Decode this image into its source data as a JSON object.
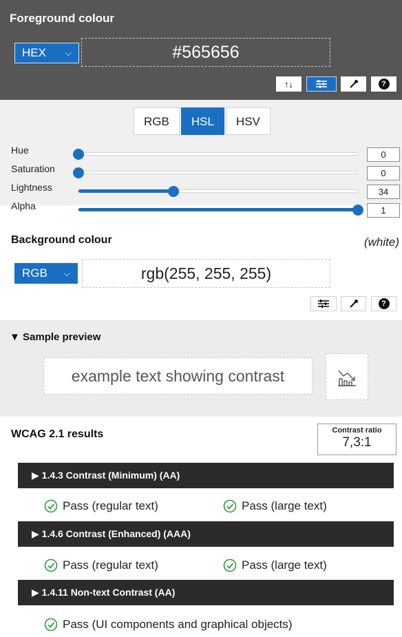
{
  "foreground": {
    "title": "Foreground colour",
    "format": "HEX",
    "value": "#565656",
    "tools": [
      "swap-icon",
      "sliders-icon",
      "eyedropper-icon",
      "help-icon"
    ],
    "help_glyph": "?",
    "swap_glyph": "↑↓",
    "background_color": "#565656"
  },
  "sliders": {
    "tabs": [
      "RGB",
      "HSL",
      "HSV"
    ],
    "active_tab": "HSL",
    "rows": [
      {
        "label": "Hue",
        "value": "0",
        "fraction": 0.0
      },
      {
        "label": "Saturation",
        "value": "0",
        "fraction": 0.0
      },
      {
        "label": "Lightness",
        "value": "34",
        "fraction": 0.34
      },
      {
        "label": "Alpha",
        "value": "1",
        "fraction": 1.0
      }
    ]
  },
  "background": {
    "title": "Background colour",
    "name": "(white)",
    "format": "RGB",
    "value": "rgb(255, 255, 255)",
    "help_glyph": "?"
  },
  "preview": {
    "title": "▼ Sample preview",
    "sample_text": "example text showing contrast"
  },
  "results": {
    "title": "WCAG 2.1 results",
    "ratio_label": "Contrast ratio",
    "ratio_value": "7,3:1",
    "criteria": [
      {
        "label": "▶  1.4.3 Contrast (Minimum) (AA)",
        "results": [
          "Pass (regular text)",
          "Pass (large text)"
        ]
      },
      {
        "label": "▶  1.4.6 Contrast (Enhanced) (AAA)",
        "results": [
          "Pass (regular text)",
          "Pass (large text)"
        ]
      },
      {
        "label": "▶  1.4.11 Non-text Contrast (AA)",
        "results": [
          "Pass (UI components and graphical objects)"
        ]
      }
    ]
  },
  "colors": {
    "accent": "#1a6fc3",
    "pass": "#2e9d3e",
    "dark_bar": "#2b2b2b"
  }
}
